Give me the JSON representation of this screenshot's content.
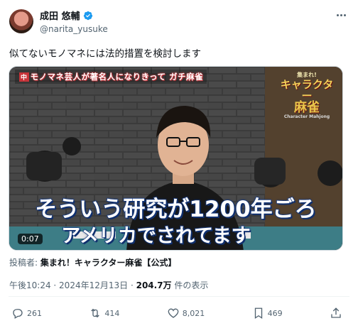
{
  "author": {
    "display_name": "成田 悠輔",
    "handle": "@narita_yusuke"
  },
  "tweet": {
    "text": "似てないモノマネには法的措置を検討します"
  },
  "media": {
    "top_caption": "モノマネ芸人が著名人になりきって ガチ麻雀",
    "badge": "中",
    "logo": {
      "line1": "集まれ!",
      "line2": "キャラクター",
      "line3": "麻雀",
      "line4": "Character Mahjong"
    },
    "subtitle_line1": "そういう研究が1200年ごろ",
    "subtitle_line2": "アメリカでされてます",
    "duration": "0:07"
  },
  "posted_by": {
    "label": "投稿者:",
    "source": "集まれ！キャラクター麻雀【公式】"
  },
  "meta": {
    "time": "午後10:24",
    "separator": " · ",
    "date": "2024年12月13日",
    "views": "204.7万",
    "views_suffix": " 件の表示"
  },
  "actions": {
    "replies": "261",
    "retweets": "414",
    "likes": "8,021",
    "bookmarks": "469"
  },
  "colors": {
    "verified": "#1d9bf0",
    "secondary_text": "#536471"
  }
}
